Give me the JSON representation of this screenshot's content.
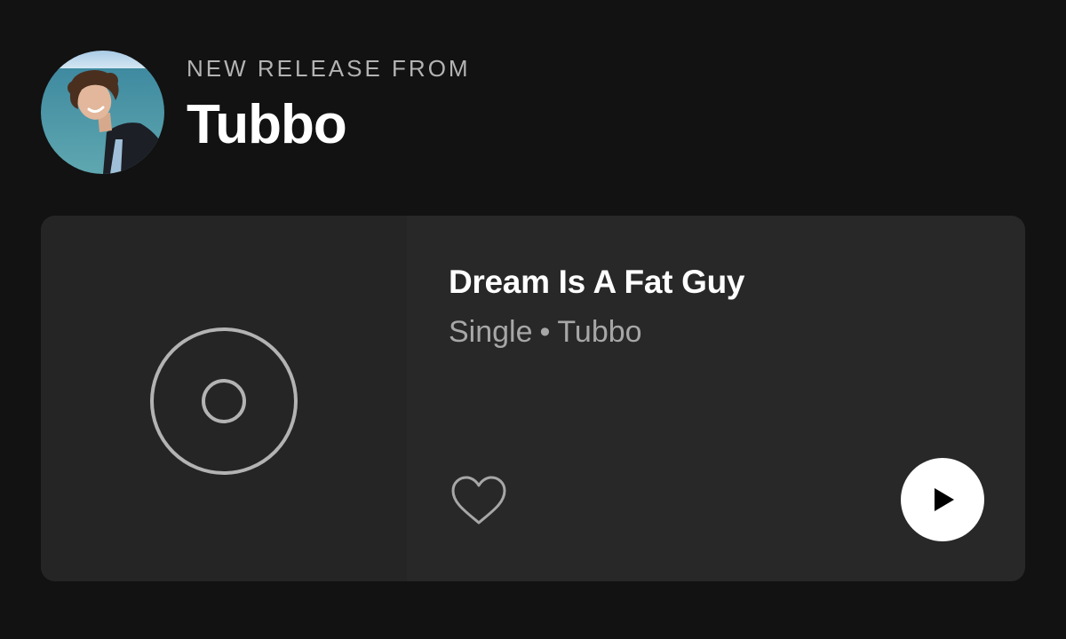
{
  "header": {
    "eyebrow": "NEW RELEASE FROM",
    "artist": "Tubbo",
    "avatar_icon": "artist-avatar-photo"
  },
  "release": {
    "title": "Dream Is A Fat Guy",
    "type": "Single",
    "separator": "•",
    "artist": "Tubbo",
    "cover_icon": "album-placeholder-icon"
  },
  "actions": {
    "like_icon": "heart-outline-icon",
    "play_icon": "play-icon"
  },
  "colors": {
    "background": "#121212",
    "card": "#282828",
    "cover": "#252525",
    "text_primary": "#ffffff",
    "text_secondary": "#a7a7a7",
    "play_button": "#ffffff"
  }
}
